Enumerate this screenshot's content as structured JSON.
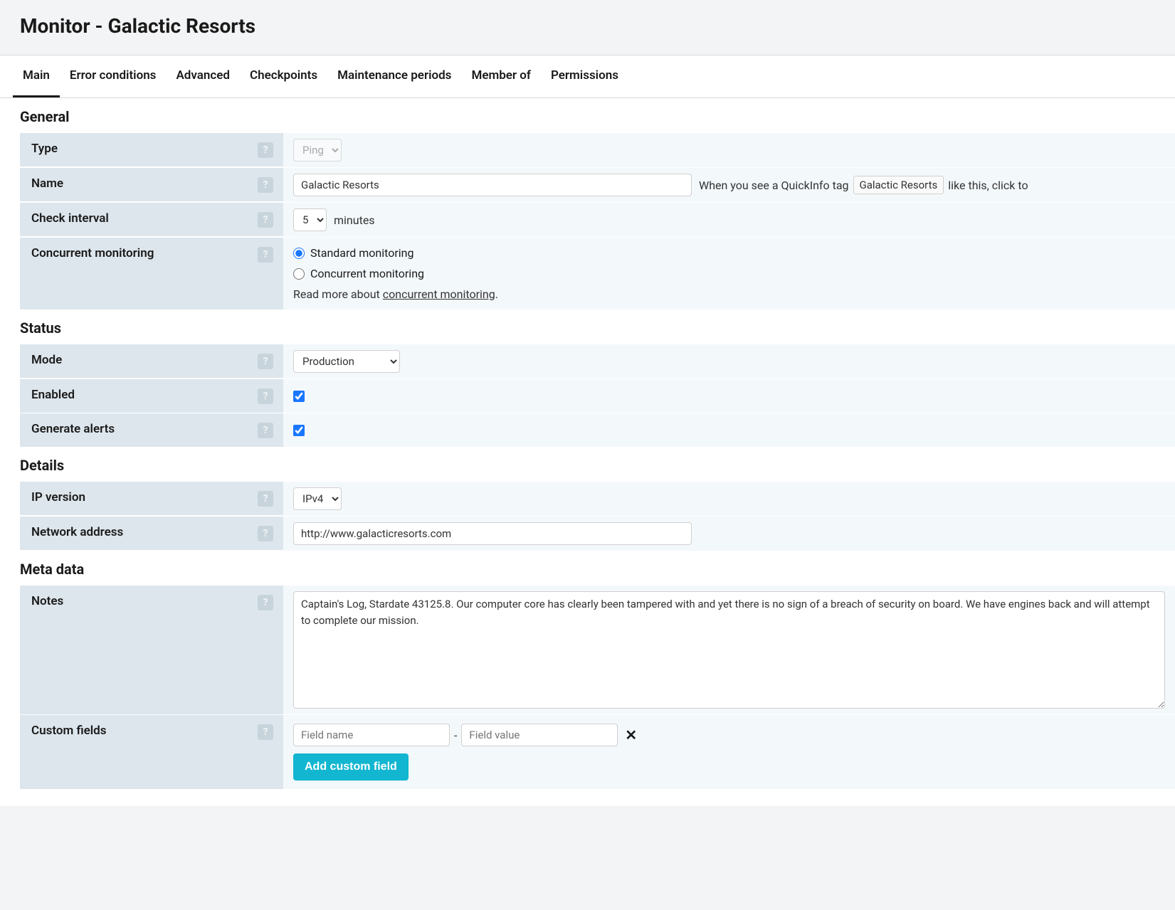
{
  "header": {
    "title": "Monitor - Galactic Resorts"
  },
  "tabs": {
    "main": "Main",
    "error_conditions": "Error conditions",
    "advanced": "Advanced",
    "checkpoints": "Checkpoints",
    "maintenance_periods": "Maintenance periods",
    "member_of": "Member of",
    "permissions": "Permissions"
  },
  "sections": {
    "general": "General",
    "status": "Status",
    "details": "Details",
    "metadata": "Meta data"
  },
  "labels": {
    "type": "Type",
    "name": "Name",
    "check_interval": "Check interval",
    "concurrent_monitoring": "Concurrent monitoring",
    "mode": "Mode",
    "enabled": "Enabled",
    "generate_alerts": "Generate alerts",
    "ip_version": "IP version",
    "network_address": "Network address",
    "notes": "Notes",
    "custom_fields": "Custom fields"
  },
  "general": {
    "type_value": "Ping",
    "name_value": "Galactic Resorts",
    "interval_value": "5",
    "interval_unit": "minutes",
    "hint_pre": "When you see a QuickInfo tag",
    "hint_tag": "Galactic Resorts",
    "hint_post": "like this, click to",
    "monitoring": {
      "standard": "Standard monitoring",
      "concurrent": "Concurrent monitoring",
      "read_more_pre": "Read more about ",
      "read_more_link": "concurrent monitoring",
      "read_more_post": "."
    }
  },
  "status": {
    "mode_value": "Production",
    "enabled": true,
    "generate_alerts": true
  },
  "details": {
    "ip_version_value": "IPv4",
    "network_address_value": "http://www.galacticresorts.com"
  },
  "metadata": {
    "notes_value": "Captain's Log, Stardate 43125.8. Our computer core has clearly been tampered with and yet there is no sign of a breach of security on board. We have engines back and will attempt to complete our mission.",
    "field_name_placeholder": "Field name",
    "field_value_placeholder": "Field value",
    "add_button": "Add custom field"
  },
  "help_glyph": "?"
}
